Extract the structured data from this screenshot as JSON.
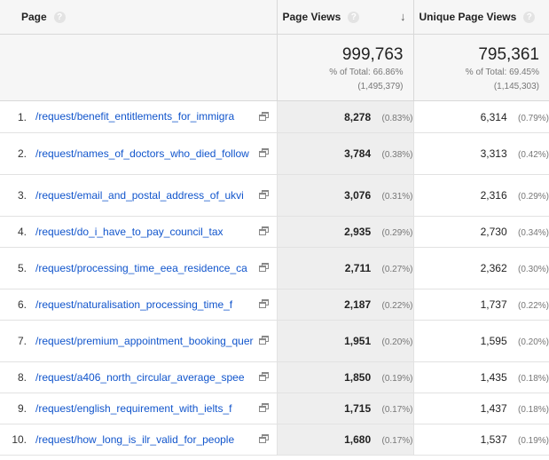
{
  "headers": {
    "page": "Page",
    "page_views": "Page Views",
    "unique_page_views": "Unique Page Views",
    "help_icon": "?",
    "sort_icon": "arrow-down-icon"
  },
  "totals": {
    "page_views": {
      "value": "999,763",
      "pct_line": "% of Total: 66.86%",
      "total_line": "(1,495,379)"
    },
    "unique_page_views": {
      "value": "795,361",
      "pct_line": "% of Total: 69.45%",
      "total_line": "(1,145,303)"
    }
  },
  "rows": [
    {
      "index": "1.",
      "page": "/request/benefit_entitlements_for_immigra",
      "pv": "8,278",
      "pv_pct": "(0.83%)",
      "upv": "6,314",
      "upv_pct": "(0.79%)"
    },
    {
      "index": "2.",
      "page": "/request/names_of_doctors_who_died_follow",
      "pv": "3,784",
      "pv_pct": "(0.38%)",
      "upv": "3,313",
      "upv_pct": "(0.42%)"
    },
    {
      "index": "3.",
      "page": "/request/email_and_postal_address_of_ukvi",
      "pv": "3,076",
      "pv_pct": "(0.31%)",
      "upv": "2,316",
      "upv_pct": "(0.29%)"
    },
    {
      "index": "4.",
      "page": "/request/do_i_have_to_pay_council_tax",
      "pv": "2,935",
      "pv_pct": "(0.29%)",
      "upv": "2,730",
      "upv_pct": "(0.34%)"
    },
    {
      "index": "5.",
      "page": "/request/processing_time_eea_residence_ca",
      "pv": "2,711",
      "pv_pct": "(0.27%)",
      "upv": "2,362",
      "upv_pct": "(0.30%)"
    },
    {
      "index": "6.",
      "page": "/request/naturalisation_processing_time_f",
      "pv": "2,187",
      "pv_pct": "(0.22%)",
      "upv": "1,737",
      "upv_pct": "(0.22%)"
    },
    {
      "index": "7.",
      "page": "/request/premium_appointment_booking_quer",
      "pv": "1,951",
      "pv_pct": "(0.20%)",
      "upv": "1,595",
      "upv_pct": "(0.20%)"
    },
    {
      "index": "8.",
      "page": "/request/a406_north_circular_average_spee",
      "pv": "1,850",
      "pv_pct": "(0.19%)",
      "upv": "1,435",
      "upv_pct": "(0.18%)"
    },
    {
      "index": "9.",
      "page": "/request/english_requirement_with_ielts_f",
      "pv": "1,715",
      "pv_pct": "(0.17%)",
      "upv": "1,437",
      "upv_pct": "(0.18%)"
    },
    {
      "index": "10.",
      "page": "/request/how_long_is_ilr_valid_for_people",
      "pv": "1,680",
      "pv_pct": "(0.17%)",
      "upv": "1,537",
      "upv_pct": "(0.19%)"
    }
  ],
  "colors": {
    "link": "#1155cc",
    "header_bg": "#f6f6f6",
    "sorted_column_bg": "#eeeeee",
    "border": "#d8d8d8",
    "muted": "#777777"
  }
}
